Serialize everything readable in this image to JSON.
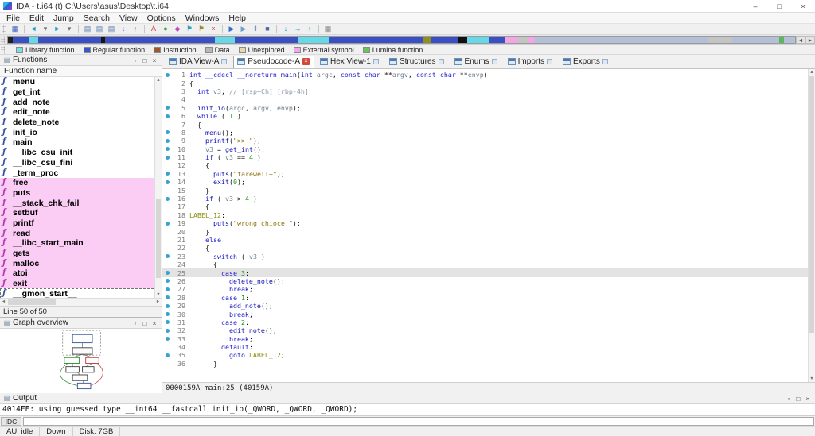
{
  "window": {
    "title": "IDA - t.i64 (t) C:\\Users\\asus\\Desktop\\t.i64"
  },
  "icons": {
    "minimize": "–",
    "maximize": "□",
    "close": "×",
    "float": "▫",
    "up": "▲",
    "down": "▼",
    "left": "◄",
    "right": "►",
    "panel": "▤"
  },
  "menu": {
    "items": [
      "File",
      "Edit",
      "Jump",
      "Search",
      "View",
      "Options",
      "Windows",
      "Help"
    ]
  },
  "toolbar": {
    "icons": [
      {
        "name": "save-database-icon",
        "glyph": "▦",
        "color": "#3a63c0"
      },
      {
        "sep": true
      },
      {
        "name": "nav-back-icon",
        "glyph": "◄",
        "color": "#19a3c9"
      },
      {
        "name": "nav-back-menu-icon",
        "glyph": "▾",
        "color": "#707070"
      },
      {
        "name": "nav-forward-icon",
        "glyph": "►",
        "color": "#19a3c9"
      },
      {
        "name": "nav-forward-menu-icon",
        "glyph": "▾",
        "color": "#707070"
      },
      {
        "sep": true
      },
      {
        "name": "jump-address-icon",
        "glyph": "▤",
        "color": "#5a7fae"
      },
      {
        "name": "jump-name-icon",
        "glyph": "▤",
        "color": "#5a7fae"
      },
      {
        "name": "jump-function-icon",
        "glyph": "▤",
        "color": "#5a7fae"
      },
      {
        "name": "jump-next-icon",
        "glyph": "↓",
        "color": "#2f6fd0"
      },
      {
        "name": "jump-prev-icon",
        "glyph": "↑",
        "color": "#2f6fd0"
      },
      {
        "sep": true
      },
      {
        "name": "colors-icon",
        "glyph": "A",
        "color": "#c03a3a"
      },
      {
        "name": "lumina-icon",
        "glyph": "●",
        "color": "#35a84f"
      },
      {
        "name": "demangle-icon",
        "glyph": "◆",
        "color": "#c04ac0"
      },
      {
        "name": "flag-cyan-icon",
        "glyph": "⚑",
        "color": "#2a9fbf"
      },
      {
        "name": "flag-olive-icon",
        "glyph": "⚑",
        "color": "#9a8a2a"
      },
      {
        "name": "close-view-icon",
        "glyph": "×",
        "color": "#cc2f2f"
      },
      {
        "sep": true
      },
      {
        "name": "debugger-start-icon",
        "glyph": "▶",
        "color": "#2f6fd0"
      },
      {
        "name": "debugger-attach-icon",
        "glyph": "▶",
        "color": "#6f9fd0"
      },
      {
        "name": "debugger-pause-icon",
        "glyph": "‖",
        "color": "#4a6a9f"
      },
      {
        "name": "debugger-stop-icon",
        "glyph": "■",
        "color": "#4a6a9f"
      },
      {
        "sep": true
      },
      {
        "name": "step-into-icon",
        "glyph": "↓",
        "color": "#19a3c9"
      },
      {
        "name": "step-over-icon",
        "glyph": "→",
        "color": "#19a3c9"
      },
      {
        "name": "run-until-return-icon",
        "glyph": "↑",
        "color": "#19a3c9"
      },
      {
        "sep": true
      },
      {
        "name": "breakpoint-list-icon",
        "glyph": "▦",
        "color": "#8a8a8a"
      }
    ]
  },
  "navband": {
    "segments": [
      {
        "color": "#202020",
        "width": 0.6
      },
      {
        "color": "#3a4fc4",
        "width": 2.0
      },
      {
        "color": "#66d9e8",
        "width": 1.2
      },
      {
        "color": "#3a4fc4",
        "width": 8.0
      },
      {
        "color": "#151515",
        "width": 0.5
      },
      {
        "color": "#3a4fc4",
        "width": 14.0
      },
      {
        "color": "#66d9e8",
        "width": 2.5
      },
      {
        "color": "#3a4fc4",
        "width": 8.0
      },
      {
        "color": "#66d9e8",
        "width": 4.0
      },
      {
        "color": "#3a4fc4",
        "width": 12.0
      },
      {
        "color": "#8f8f1f",
        "width": 0.9
      },
      {
        "color": "#3a4fc4",
        "width": 3.5
      },
      {
        "color": "#101010",
        "width": 1.2
      },
      {
        "color": "#66d9e8",
        "width": 2.8
      },
      {
        "color": "#3a4fc4",
        "width": 2.0
      },
      {
        "color": "#f2a6e4",
        "width": 1.6
      },
      {
        "color": "#c4c4c4",
        "width": 1.2
      },
      {
        "color": "#f2a6e4",
        "width": 1.0
      },
      {
        "color": "#b3c0d8",
        "width": 22.0
      },
      {
        "color": "#c4c4c4",
        "width": 3.0
      },
      {
        "color": "#b3c0d8",
        "width": 6.0
      },
      {
        "color": "#58b858",
        "width": 0.6
      },
      {
        "color": "#b3c0d8",
        "width": 1.4
      }
    ]
  },
  "legend": {
    "items": [
      {
        "label": "Library function",
        "color": "#79dfe8"
      },
      {
        "label": "Regular function",
        "color": "#3c55c8"
      },
      {
        "label": "Instruction",
        "color": "#9a5a30"
      },
      {
        "label": "Data",
        "color": "#b8b8b8"
      },
      {
        "label": "Unexplored",
        "color": "#e8d8ae"
      },
      {
        "label": "External symbol",
        "color": "#f4a8ec"
      },
      {
        "label": "Lumina function",
        "color": "#66c657"
      }
    ]
  },
  "functions_panel": {
    "title": "Functions",
    "column_header": "Function name",
    "status": "Line 50 of 50",
    "items": [
      {
        "name": "menu",
        "kind": "regular"
      },
      {
        "name": "get_int",
        "kind": "regular"
      },
      {
        "name": "add_note",
        "kind": "regular"
      },
      {
        "name": "edit_note",
        "kind": "regular"
      },
      {
        "name": "delete_note",
        "kind": "regular"
      },
      {
        "name": "init_io",
        "kind": "regular"
      },
      {
        "name": "main",
        "kind": "regular"
      },
      {
        "name": "__libc_csu_init",
        "kind": "regular"
      },
      {
        "name": "__libc_csu_fini",
        "kind": "regular"
      },
      {
        "name": "_term_proc",
        "kind": "regular"
      },
      {
        "name": "free",
        "kind": "import"
      },
      {
        "name": "puts",
        "kind": "import"
      },
      {
        "name": "__stack_chk_fail",
        "kind": "import"
      },
      {
        "name": "setbuf",
        "kind": "import"
      },
      {
        "name": "printf",
        "kind": "import"
      },
      {
        "name": "read",
        "kind": "import"
      },
      {
        "name": "__libc_start_main",
        "kind": "import"
      },
      {
        "name": "gets",
        "kind": "import"
      },
      {
        "name": "malloc",
        "kind": "import"
      },
      {
        "name": "atoi",
        "kind": "import"
      },
      {
        "name": "exit",
        "kind": "import"
      },
      {
        "name": "__gmon_start__",
        "kind": "regular",
        "focused": true
      }
    ]
  },
  "graph_overview": {
    "title": "Graph overview"
  },
  "tabs": [
    {
      "label": "IDA View-A",
      "active": false
    },
    {
      "label": "Pseudocode-A",
      "active": true
    },
    {
      "label": "Hex View-1",
      "active": false
    },
    {
      "label": "Structures",
      "active": false
    },
    {
      "label": "Enums",
      "active": false
    },
    {
      "label": "Imports",
      "active": false
    },
    {
      "label": "Exports",
      "active": false
    }
  ],
  "code": {
    "current_line": 25,
    "status": "0000159A main:25 (40159A)",
    "lines": [
      {
        "n": 1,
        "dot": true,
        "seg": [
          [
            "k",
            "int"
          ],
          [
            "p",
            " "
          ],
          [
            "k",
            "__cdecl"
          ],
          [
            "p",
            " "
          ],
          [
            "k",
            "__noreturn"
          ],
          [
            "p",
            " "
          ],
          [
            "f",
            "main"
          ],
          [
            "p",
            "("
          ],
          [
            "k",
            "int"
          ],
          [
            "p",
            " "
          ],
          [
            "v",
            "argc"
          ],
          [
            "p",
            ", "
          ],
          [
            "k",
            "const"
          ],
          [
            "p",
            " "
          ],
          [
            "k",
            "char"
          ],
          [
            "p",
            " **"
          ],
          [
            "v",
            "argv"
          ],
          [
            "p",
            ", "
          ],
          [
            "k",
            "const"
          ],
          [
            "p",
            " "
          ],
          [
            "k",
            "char"
          ],
          [
            "p",
            " **"
          ],
          [
            "v",
            "envp"
          ],
          [
            "p",
            ")"
          ]
        ]
      },
      {
        "n": 2,
        "dot": false,
        "seg": [
          [
            "p",
            "{"
          ]
        ]
      },
      {
        "n": 3,
        "dot": false,
        "seg": [
          [
            "p",
            "  "
          ],
          [
            "k",
            "int"
          ],
          [
            "p",
            " "
          ],
          [
            "v",
            "v3"
          ],
          [
            "p",
            "; "
          ],
          [
            "c",
            "// [rsp+Ch] [rbp-4h]"
          ]
        ]
      },
      {
        "n": 4,
        "dot": false,
        "seg": []
      },
      {
        "n": 5,
        "dot": true,
        "seg": [
          [
            "p",
            "  "
          ],
          [
            "f",
            "init_io"
          ],
          [
            "p",
            "("
          ],
          [
            "v",
            "argc"
          ],
          [
            "p",
            ", "
          ],
          [
            "v",
            "argv"
          ],
          [
            "p",
            ", "
          ],
          [
            "v",
            "envp"
          ],
          [
            "p",
            ");"
          ]
        ]
      },
      {
        "n": 6,
        "dot": true,
        "seg": [
          [
            "p",
            "  "
          ],
          [
            "k",
            "while"
          ],
          [
            "p",
            " ( "
          ],
          [
            "n",
            "1"
          ],
          [
            "p",
            " )"
          ]
        ]
      },
      {
        "n": 7,
        "dot": false,
        "seg": [
          [
            "p",
            "  {"
          ]
        ]
      },
      {
        "n": 8,
        "dot": true,
        "seg": [
          [
            "p",
            "    "
          ],
          [
            "f",
            "menu"
          ],
          [
            "p",
            "();"
          ]
        ]
      },
      {
        "n": 9,
        "dot": true,
        "seg": [
          [
            "p",
            "    "
          ],
          [
            "f",
            "printf"
          ],
          [
            "p",
            "("
          ],
          [
            "s",
            "\">> \""
          ],
          [
            "p",
            ");"
          ]
        ]
      },
      {
        "n": 10,
        "dot": true,
        "seg": [
          [
            "p",
            "    "
          ],
          [
            "v",
            "v3"
          ],
          [
            "p",
            " = "
          ],
          [
            "f",
            "get_int"
          ],
          [
            "p",
            "();"
          ]
        ]
      },
      {
        "n": 11,
        "dot": true,
        "seg": [
          [
            "p",
            "    "
          ],
          [
            "k",
            "if"
          ],
          [
            "p",
            " ( "
          ],
          [
            "v",
            "v3"
          ],
          [
            "p",
            " == "
          ],
          [
            "n",
            "4"
          ],
          [
            "p",
            " )"
          ]
        ]
      },
      {
        "n": 12,
        "dot": false,
        "seg": [
          [
            "p",
            "    {"
          ]
        ]
      },
      {
        "n": 13,
        "dot": true,
        "seg": [
          [
            "p",
            "      "
          ],
          [
            "f",
            "puts"
          ],
          [
            "p",
            "("
          ],
          [
            "s",
            "\"farewell~\""
          ],
          [
            "p",
            ");"
          ]
        ]
      },
      {
        "n": 14,
        "dot": true,
        "seg": [
          [
            "p",
            "      "
          ],
          [
            "f",
            "exit"
          ],
          [
            "p",
            "("
          ],
          [
            "n",
            "0"
          ],
          [
            "p",
            ");"
          ]
        ]
      },
      {
        "n": 15,
        "dot": false,
        "seg": [
          [
            "p",
            "    }"
          ]
        ]
      },
      {
        "n": 16,
        "dot": true,
        "seg": [
          [
            "p",
            "    "
          ],
          [
            "k",
            "if"
          ],
          [
            "p",
            " ( "
          ],
          [
            "v",
            "v3"
          ],
          [
            "p",
            " > "
          ],
          [
            "n",
            "4"
          ],
          [
            "p",
            " )"
          ]
        ]
      },
      {
        "n": 17,
        "dot": false,
        "seg": [
          [
            "p",
            "    {"
          ]
        ]
      },
      {
        "n": 18,
        "dot": false,
        "seg": [
          [
            "l",
            "LABEL_12"
          ],
          [
            "p",
            ":"
          ]
        ]
      },
      {
        "n": 19,
        "dot": true,
        "seg": [
          [
            "p",
            "      "
          ],
          [
            "f",
            "puts"
          ],
          [
            "p",
            "("
          ],
          [
            "s",
            "\"wrong chioce!\""
          ],
          [
            "p",
            ");"
          ]
        ]
      },
      {
        "n": 20,
        "dot": false,
        "seg": [
          [
            "p",
            "    }"
          ]
        ]
      },
      {
        "n": 21,
        "dot": false,
        "seg": [
          [
            "p",
            "    "
          ],
          [
            "k",
            "else"
          ]
        ]
      },
      {
        "n": 22,
        "dot": false,
        "seg": [
          [
            "p",
            "    {"
          ]
        ]
      },
      {
        "n": 23,
        "dot": true,
        "seg": [
          [
            "p",
            "      "
          ],
          [
            "k",
            "switch"
          ],
          [
            "p",
            " ( "
          ],
          [
            "v",
            "v3"
          ],
          [
            "p",
            " )"
          ]
        ]
      },
      {
        "n": 24,
        "dot": false,
        "seg": [
          [
            "p",
            "      {"
          ]
        ]
      },
      {
        "n": 25,
        "dot": true,
        "seg": [
          [
            "p",
            "        "
          ],
          [
            "k",
            "case"
          ],
          [
            "p",
            " "
          ],
          [
            "n",
            "3"
          ],
          [
            "p",
            ":"
          ]
        ]
      },
      {
        "n": 26,
        "dot": true,
        "seg": [
          [
            "p",
            "          "
          ],
          [
            "f",
            "delete_note"
          ],
          [
            "p",
            "();"
          ]
        ]
      },
      {
        "n": 27,
        "dot": true,
        "seg": [
          [
            "p",
            "          "
          ],
          [
            "k",
            "break"
          ],
          [
            "p",
            ";"
          ]
        ]
      },
      {
        "n": 28,
        "dot": true,
        "seg": [
          [
            "p",
            "        "
          ],
          [
            "k",
            "case"
          ],
          [
            "p",
            " "
          ],
          [
            "n",
            "1"
          ],
          [
            "p",
            ":"
          ]
        ]
      },
      {
        "n": 29,
        "dot": true,
        "seg": [
          [
            "p",
            "          "
          ],
          [
            "f",
            "add_note"
          ],
          [
            "p",
            "();"
          ]
        ]
      },
      {
        "n": 30,
        "dot": true,
        "seg": [
          [
            "p",
            "          "
          ],
          [
            "k",
            "break"
          ],
          [
            "p",
            ";"
          ]
        ]
      },
      {
        "n": 31,
        "dot": true,
        "seg": [
          [
            "p",
            "        "
          ],
          [
            "k",
            "case"
          ],
          [
            "p",
            " "
          ],
          [
            "n",
            "2"
          ],
          [
            "p",
            ":"
          ]
        ]
      },
      {
        "n": 32,
        "dot": true,
        "seg": [
          [
            "p",
            "          "
          ],
          [
            "f",
            "edit_note"
          ],
          [
            "p",
            "();"
          ]
        ]
      },
      {
        "n": 33,
        "dot": true,
        "seg": [
          [
            "p",
            "          "
          ],
          [
            "k",
            "break"
          ],
          [
            "p",
            ";"
          ]
        ]
      },
      {
        "n": 34,
        "dot": false,
        "seg": [
          [
            "p",
            "        "
          ],
          [
            "k",
            "default"
          ],
          [
            "p",
            ":"
          ]
        ]
      },
      {
        "n": 35,
        "dot": true,
        "seg": [
          [
            "p",
            "          "
          ],
          [
            "k",
            "goto"
          ],
          [
            "p",
            " "
          ],
          [
            "l",
            "LABEL_12"
          ],
          [
            "p",
            ";"
          ]
        ]
      },
      {
        "n": 36,
        "dot": false,
        "seg": [
          [
            "p",
            "      }"
          ]
        ]
      }
    ]
  },
  "output_panel": {
    "title": "Output",
    "lines": [
      "4014FE: using guessed type __int64 __fastcall init_io(_QWORD, _QWORD, _QWORD);"
    ],
    "cli_label": "IDC"
  },
  "statusbar": {
    "items": [
      "AU: idle",
      "Down",
      "Disk: 7GB"
    ]
  }
}
